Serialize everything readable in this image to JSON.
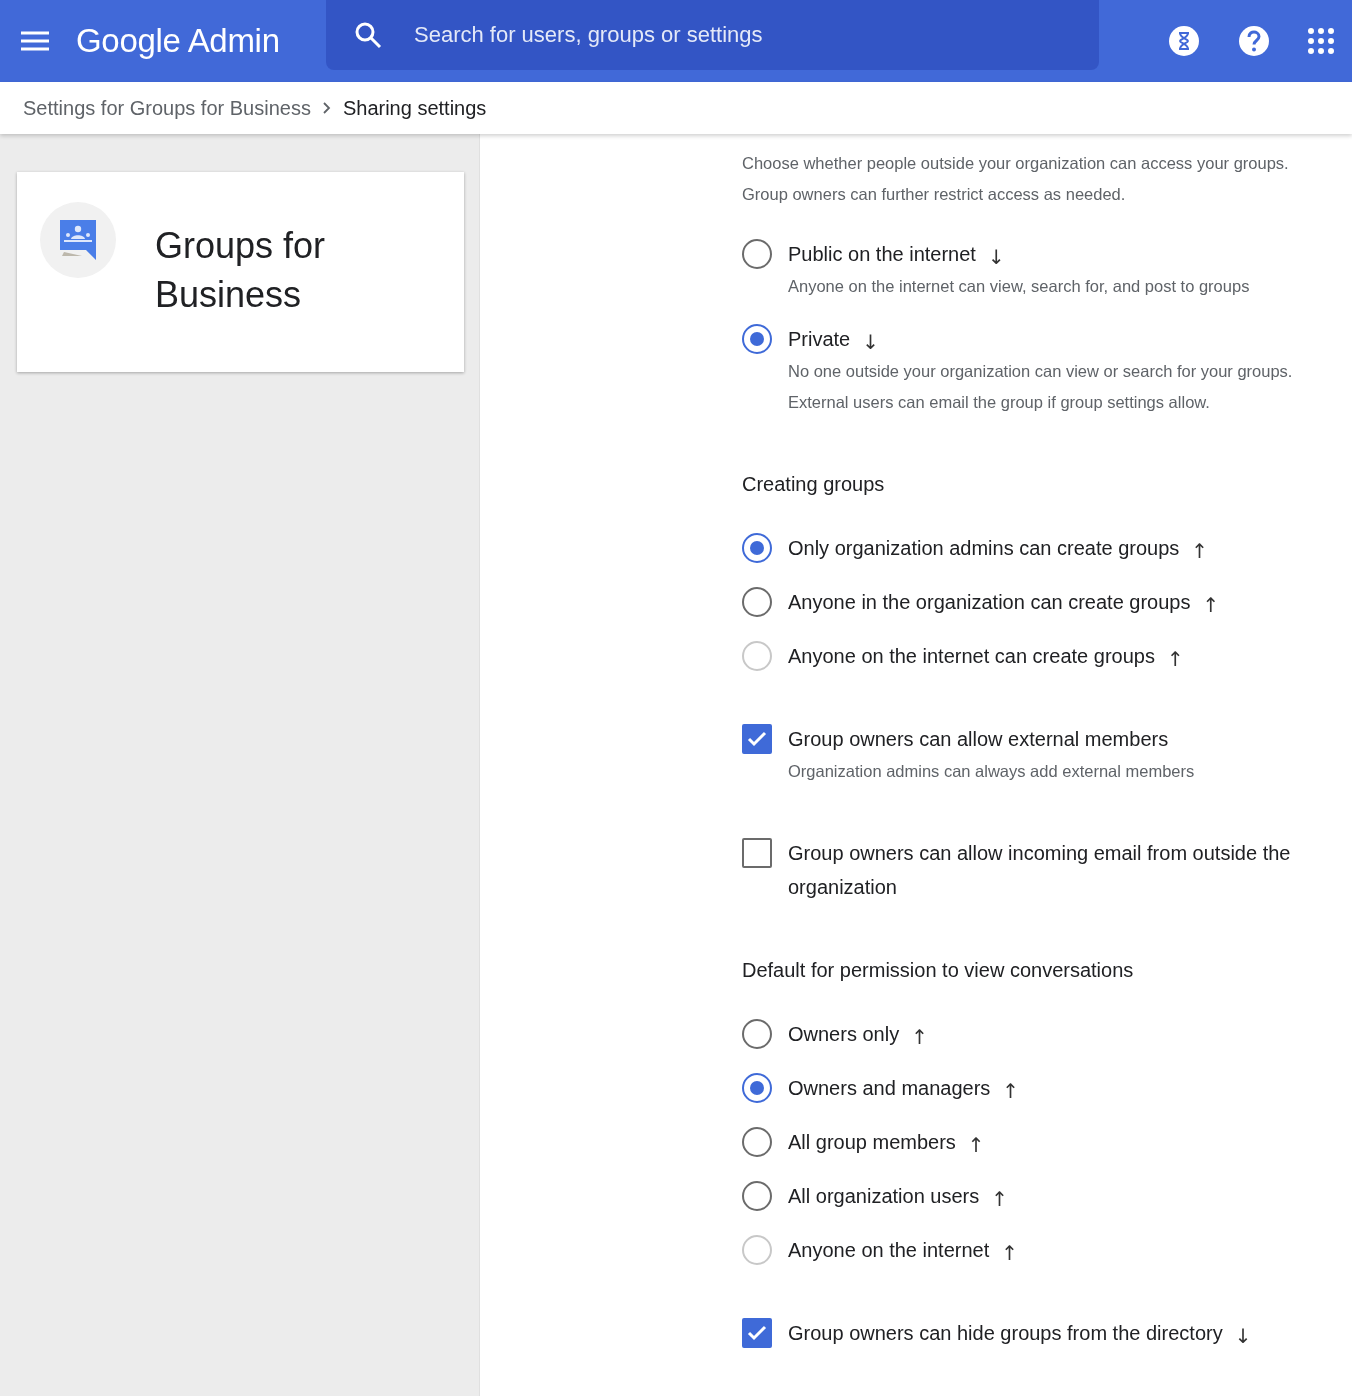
{
  "header": {
    "title": "Google Admin",
    "search": {
      "placeholder": "Search for users, groups or settings"
    }
  },
  "breadcrumb": [
    {
      "label": "Settings for Groups for Business",
      "current": false
    },
    {
      "label": "Sharing settings",
      "current": true
    }
  ],
  "card": {
    "title": "Groups for Business"
  },
  "sections": [
    {
      "description": "Choose whether people outside your organization can access your groups. Group owners can further restrict access as needed.",
      "items": [
        {
          "kind": "radio",
          "label": "Public on the internet",
          "arrow": "↓",
          "selected": false,
          "disabled": false,
          "description": "Anyone on the internet can view, search for, and post to groups"
        },
        {
          "kind": "radio",
          "label": "Private",
          "arrow": "↓",
          "selected": true,
          "disabled": false,
          "description": "No one outside your organization can view or search for your groups. External users can email the group if group settings allow."
        }
      ]
    },
    {
      "title": "Creating groups",
      "items": [
        {
          "kind": "radio",
          "label": "Only organization admins can create groups",
          "arrow": "↑",
          "selected": true,
          "disabled": false
        },
        {
          "kind": "radio",
          "label": "Anyone in the organization can create groups",
          "arrow": "↑",
          "selected": false,
          "disabled": false
        },
        {
          "kind": "radio",
          "label": "Anyone on the internet can create groups",
          "arrow": "↑",
          "selected": false,
          "disabled": true
        },
        {
          "kind": "checkbox",
          "label": "Group owners can allow external members",
          "checked": true,
          "description": "Organization admins can always add external members"
        },
        {
          "kind": "checkbox",
          "label": "Group owners can allow incoming email from outside the organization",
          "checked": false
        }
      ]
    },
    {
      "title": "Default for permission to view conversations",
      "items": [
        {
          "kind": "radio",
          "label": "Owners only",
          "arrow": "↑",
          "selected": false,
          "disabled": false
        },
        {
          "kind": "radio",
          "label": "Owners and managers",
          "arrow": "↑",
          "selected": true,
          "disabled": false
        },
        {
          "kind": "radio",
          "label": "All group members",
          "arrow": "↑",
          "selected": false,
          "disabled": false
        },
        {
          "kind": "radio",
          "label": "All organization users",
          "arrow": "↑",
          "selected": false,
          "disabled": false
        },
        {
          "kind": "radio",
          "label": "Anyone on the internet",
          "arrow": "↑",
          "selected": false,
          "disabled": true
        },
        {
          "kind": "checkbox",
          "label": "Group owners can hide groups from the directory",
          "arrow": "↓",
          "checked": true
        }
      ]
    }
  ]
}
